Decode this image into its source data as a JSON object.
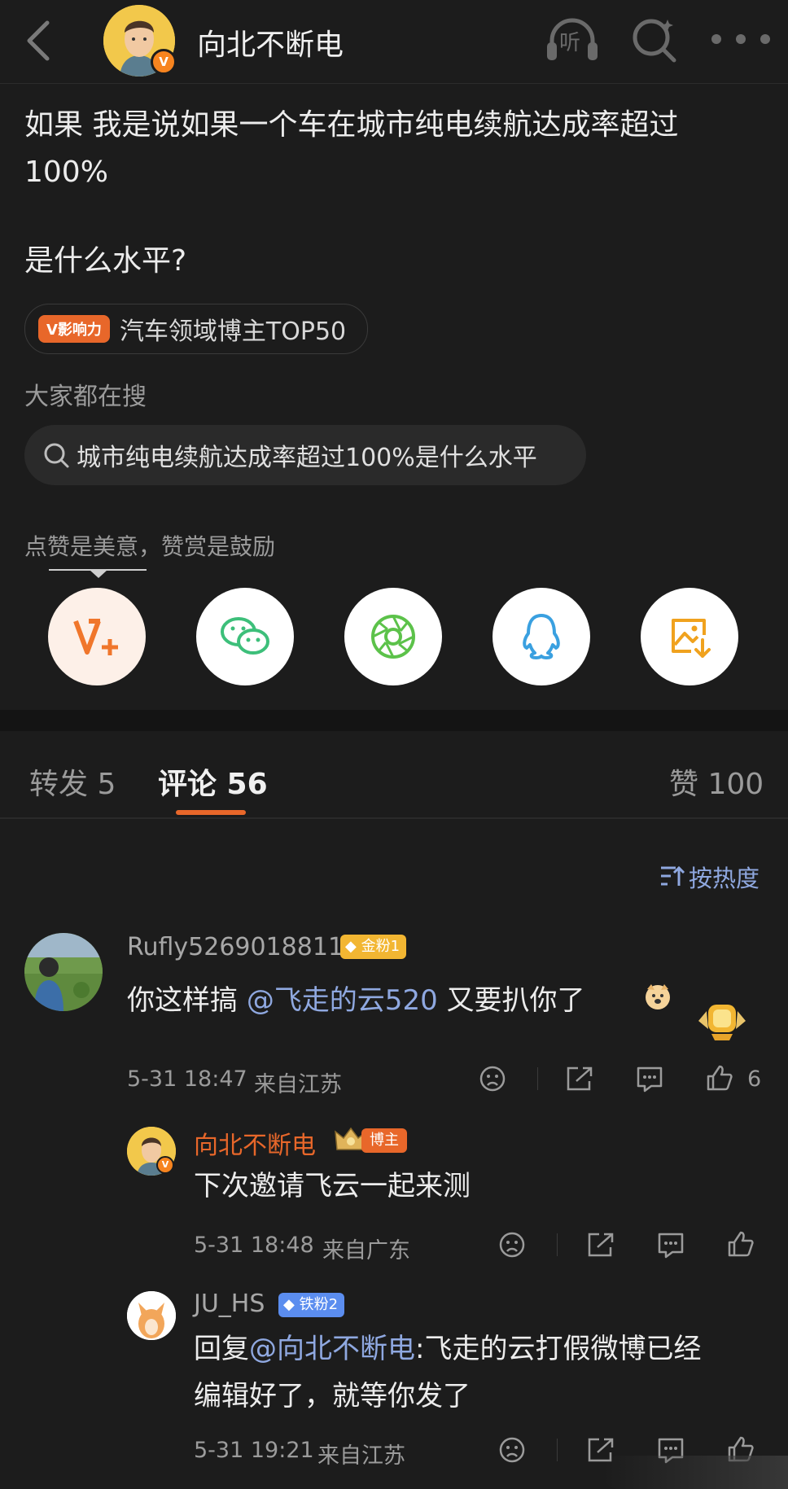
{
  "header": {
    "title": "向北不断电",
    "listen_label": "听",
    "verified_mark": "V"
  },
  "post": {
    "line1": "如果 我是说如果一个车在城市纯电续航达成率超过",
    "line2": "100%",
    "line3": "是什么水平?"
  },
  "influence": {
    "tag": "V影响力",
    "text": "汽车领域博主TOP50"
  },
  "search": {
    "label": "大家都在搜",
    "query": "城市纯电续航达成率超过100%是什么水平"
  },
  "appreciation": {
    "text": "点赞是美意，赞赏是鼓励"
  },
  "share_buttons": [
    {
      "name": "reward-icon"
    },
    {
      "name": "wechat-icon"
    },
    {
      "name": "moments-icon"
    },
    {
      "name": "qq-icon"
    },
    {
      "name": "save-image-icon"
    }
  ],
  "tabs": {
    "repost": "转发 5",
    "comments": "评论 56",
    "likes": "赞 100"
  },
  "sort": {
    "label": "按热度"
  },
  "comments": [
    {
      "user": "Rufly5269018811",
      "badge": "金粉1",
      "text_before": "你这样搞 ",
      "mention": "@飞走的云520",
      "text_after": " 又要扒你了",
      "time": "5-31 18:47",
      "location": "来自江苏",
      "likes": "6"
    }
  ],
  "replies": [
    {
      "user": "向北不断电",
      "badge": "博主",
      "text": "下次邀请飞云一起来测",
      "time": "5-31 18:48",
      "location": "来自广东"
    },
    {
      "user": "JU_HS",
      "badge": "铁粉2",
      "prefix": "回复",
      "mention": "@向北不断电",
      "text_after": ":飞走的云打假微博已经",
      "line2": "编辑好了，就等你发了",
      "time": "5-31 19:21",
      "location": "来自江苏"
    }
  ],
  "colors": {
    "background": "#1c1c1c",
    "accent_orange": "#e8672a",
    "mention_blue": "#8fa8e0",
    "gold_badge": "#f2b632",
    "iron_badge": "#5b8def"
  }
}
